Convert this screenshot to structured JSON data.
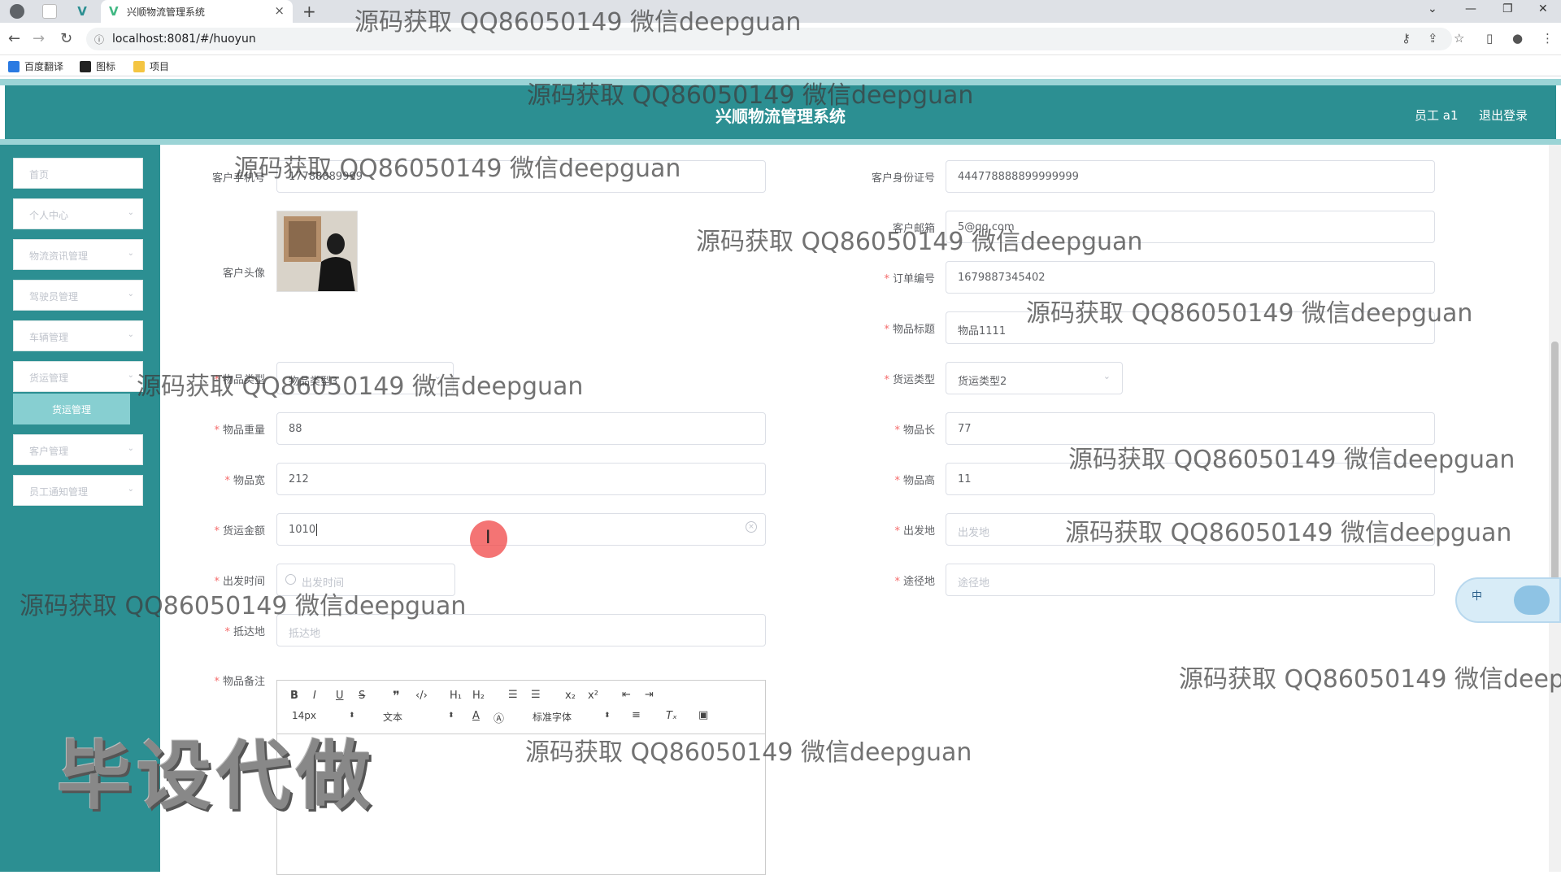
{
  "browser": {
    "tab_title": "兴顺物流管理系统",
    "tab_close": "×",
    "new_tab": "+",
    "url": "localhost:8081/#/huoyun",
    "bookmarks": [
      "百度翻译",
      "图标",
      "项目"
    ]
  },
  "header": {
    "title": "兴顺物流管理系统",
    "user": "员工 a1",
    "logout": "退出登录"
  },
  "sidebar": {
    "items": [
      {
        "label": "首页",
        "has_chevron": false
      },
      {
        "label": "个人中心",
        "has_chevron": true
      },
      {
        "label": "物流资讯管理",
        "has_chevron": true
      },
      {
        "label": "驾驶员管理",
        "has_chevron": true
      },
      {
        "label": "车辆管理",
        "has_chevron": true
      },
      {
        "label": "货运管理",
        "has_chevron": true
      },
      {
        "label": "客户管理",
        "has_chevron": true
      },
      {
        "label": "员工通知管理",
        "has_chevron": true
      }
    ],
    "active_sub": "货运管理"
  },
  "form": {
    "customer_phone": {
      "label": "客户手机号",
      "value": "17788889999"
    },
    "customer_id": {
      "label": "客户身份证号",
      "value": "444778888899999999"
    },
    "customer_avatar": {
      "label": "客户头像"
    },
    "customer_email": {
      "label": "客户邮箱",
      "value": "5@qq.com"
    },
    "order_no": {
      "label": "订单编号",
      "value": "1679887345402"
    },
    "item_title": {
      "label": "物品标题",
      "value": "物品1111"
    },
    "item_type": {
      "label": "物品类型",
      "value": "物品类型3"
    },
    "freight_type": {
      "label": "货运类型",
      "value": "货运类型2"
    },
    "item_weight": {
      "label": "物品重量",
      "value": "88"
    },
    "item_length": {
      "label": "物品长",
      "value": "77"
    },
    "item_width": {
      "label": "物品宽",
      "value": "212"
    },
    "item_height": {
      "label": "物品高",
      "value": "11"
    },
    "freight_amount": {
      "label": "货运金额",
      "value": "1010"
    },
    "departure": {
      "label": "出发地",
      "placeholder": "出发地"
    },
    "depart_time": {
      "label": "出发时间",
      "placeholder": "出发时间"
    },
    "via": {
      "label": "途径地",
      "placeholder": "途径地"
    },
    "arrival": {
      "label": "抵达地",
      "placeholder": "抵达地"
    },
    "item_note": {
      "label": "物品备注"
    }
  },
  "editor": {
    "font_size": "14px",
    "paragraph": "文本",
    "font_family": "标准字体"
  },
  "ime": {
    "label": "中"
  },
  "watermark": {
    "text": "源码获取 QQ86050149 微信deepguan",
    "text_cut": "源码获取 QQ86050149 微信deepg",
    "big": "毕设代做"
  }
}
